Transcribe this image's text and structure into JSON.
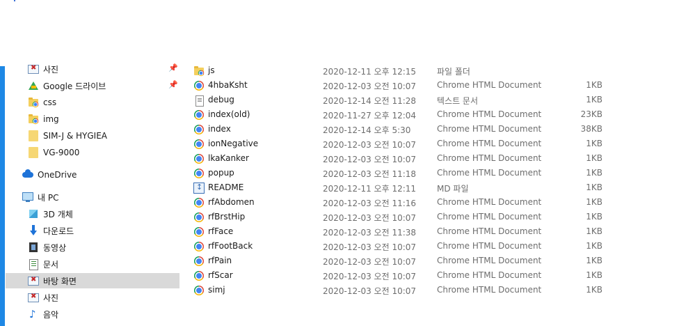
{
  "nav": {
    "items": [
      {
        "label": "사진",
        "icon": "pictures-icon",
        "pinned": true
      },
      {
        "label": "Google 드라이브",
        "icon": "google-drive-icon",
        "pinned": true
      },
      {
        "label": "css",
        "icon": "chrome-folder-icon",
        "pinned": false
      },
      {
        "label": "img",
        "icon": "chrome-folder-icon",
        "pinned": false
      },
      {
        "label": "SIM-J & HYGIEA",
        "icon": "folder-icon",
        "pinned": false
      },
      {
        "label": "VG-9000",
        "icon": "folder-icon",
        "pinned": false
      },
      {
        "label": "OneDrive",
        "icon": "onedrive-icon",
        "pinned": false
      },
      {
        "label": "내 PC",
        "icon": "this-pc-icon",
        "pinned": false
      },
      {
        "label": "3D 개체",
        "icon": "3d-objects-icon",
        "pinned": false
      },
      {
        "label": "다운로드",
        "icon": "downloads-icon",
        "pinned": false
      },
      {
        "label": "동영상",
        "icon": "videos-icon",
        "pinned": false
      },
      {
        "label": "문서",
        "icon": "documents-icon",
        "pinned": false
      },
      {
        "label": "바탕 화면",
        "icon": "desktop-icon",
        "pinned": false,
        "selected": true
      },
      {
        "label": "사진",
        "icon": "pictures-icon",
        "pinned": false
      },
      {
        "label": "음악",
        "icon": "music-icon",
        "pinned": false
      }
    ],
    "pin_glyph": "📌"
  },
  "files": [
    {
      "name": "js",
      "date": "2020-12-11 오후 12:15",
      "type": "파일 폴더",
      "size": "",
      "icon": "chrome-folder-icon"
    },
    {
      "name": "4hbaKsht",
      "date": "2020-12-03 오전 10:07",
      "type": "Chrome HTML Document",
      "size": "1KB",
      "icon": "chrome-icon"
    },
    {
      "name": "debug",
      "date": "2020-12-14 오전 11:28",
      "type": "텍스트 문서",
      "size": "1KB",
      "icon": "text-doc-icon"
    },
    {
      "name": "index(old)",
      "date": "2020-11-27 오후 12:04",
      "type": "Chrome HTML Document",
      "size": "23KB",
      "icon": "chrome-icon"
    },
    {
      "name": "index",
      "date": "2020-12-14 오후 5:30",
      "type": "Chrome HTML Document",
      "size": "38KB",
      "icon": "chrome-icon"
    },
    {
      "name": "ionNegative",
      "date": "2020-12-03 오전 10:07",
      "type": "Chrome HTML Document",
      "size": "1KB",
      "icon": "chrome-icon"
    },
    {
      "name": "lkaKanker",
      "date": "2020-12-03 오전 10:07",
      "type": "Chrome HTML Document",
      "size": "1KB",
      "icon": "chrome-icon"
    },
    {
      "name": "popup",
      "date": "2020-12-03 오전 11:18",
      "type": "Chrome HTML Document",
      "size": "1KB",
      "icon": "chrome-icon"
    },
    {
      "name": "README",
      "date": "2020-12-11 오후 12:11",
      "type": "MD 파일",
      "size": "1KB",
      "icon": "markdown-icon"
    },
    {
      "name": "rfAbdomen",
      "date": "2020-12-03 오전 11:16",
      "type": "Chrome HTML Document",
      "size": "1KB",
      "icon": "chrome-icon"
    },
    {
      "name": "rfBrstHip",
      "date": "2020-12-03 오전 10:07",
      "type": "Chrome HTML Document",
      "size": "1KB",
      "icon": "chrome-icon"
    },
    {
      "name": "rfFace",
      "date": "2020-12-03 오전 11:38",
      "type": "Chrome HTML Document",
      "size": "1KB",
      "icon": "chrome-icon"
    },
    {
      "name": "rfFootBack",
      "date": "2020-12-03 오전 10:07",
      "type": "Chrome HTML Document",
      "size": "1KB",
      "icon": "chrome-icon"
    },
    {
      "name": "rfPain",
      "date": "2020-12-03 오전 10:07",
      "type": "Chrome HTML Document",
      "size": "1KB",
      "icon": "chrome-icon"
    },
    {
      "name": "rfScar",
      "date": "2020-12-03 오전 10:07",
      "type": "Chrome HTML Document",
      "size": "1KB",
      "icon": "chrome-icon"
    },
    {
      "name": "simj",
      "date": "2020-12-03 오전 10:07",
      "type": "Chrome HTML Document",
      "size": "1KB",
      "icon": "chrome-icon"
    }
  ],
  "colors": {
    "accent": "#1e88e5",
    "selected_bg": "#d9d9d9",
    "secondary_text": "#6d6d6d"
  }
}
